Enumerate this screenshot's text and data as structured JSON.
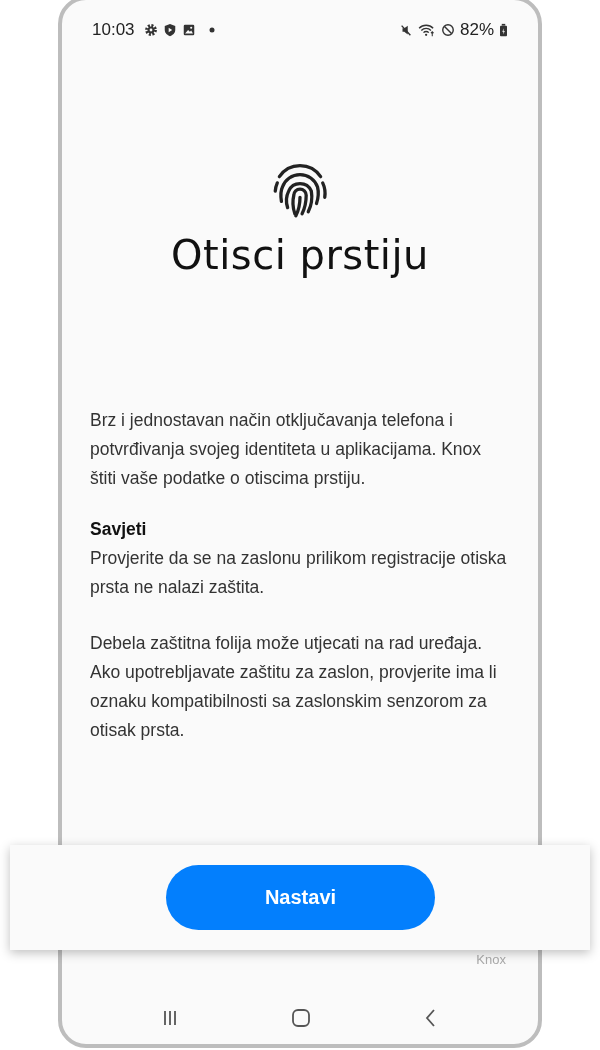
{
  "status_bar": {
    "time": "10:03",
    "battery": "82%"
  },
  "title": "Otisci prstiju",
  "intro": "Brz i jednostavan način otključavanja telefona i potvrđivanja svojeg identiteta u aplikacijama. Knox štiti vaše podatke o otiscima prstiju.",
  "tips": {
    "heading": "Savjeti",
    "paragraphs": [
      "Provjerite da se na zaslonu prilikom registracije otiska prsta ne nalazi zaštita.",
      "Debela zaštitna folija može utjecati na rad uređaja. Ako upotrebljavate zaštitu za zaslon, provjerite ima li oznaku kompatibilnosti sa zaslonskim senzorom za otisak prsta."
    ]
  },
  "button": "Nastavi",
  "footer": "Knox"
}
